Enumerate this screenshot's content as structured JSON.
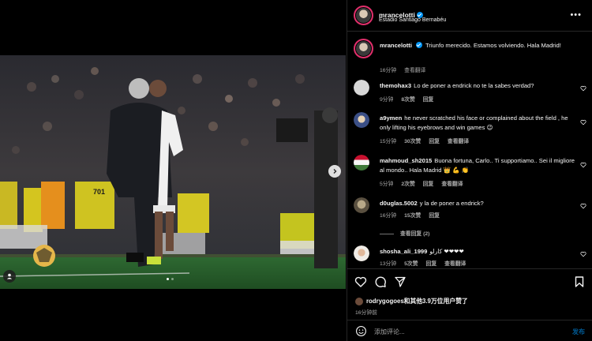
{
  "post": {
    "author": "mrancelotti",
    "location": "Estadio Santiago Bernabéu",
    "caption": "Triunfo merecido. Estamos volviendo. Hala Madrid!",
    "caption_time": "16分钟",
    "see_translation": "查看翻译"
  },
  "comments": [
    {
      "user": "themohax3",
      "text": "Lo de poner a endrick no te la sabes verdad?",
      "time": "9分钟",
      "likes": "8次赞",
      "reply": "回复",
      "translate": "",
      "avatar_color": "#d8d8d8"
    },
    {
      "user": "a9ymen",
      "text": "he never scratched his face or complained about the field , he only lifting his eyebrows and win games 😉",
      "time": "15分钟",
      "likes": "30次赞",
      "reply": "回复",
      "translate": "查看翻译",
      "avatar_color": "#4a5d8f"
    },
    {
      "user": "mahmoud_sh2015",
      "text": "Buona fortuna, Carlo.. Ti supportiamo.. Sei il migliore al mondo.. Hala Madrid 👑 💪 👏",
      "time": "5分钟",
      "likes": "2次赞",
      "reply": "回复",
      "translate": "查看翻译",
      "avatar_color": "#3f7a3a"
    },
    {
      "user": "d0uglas.5002",
      "text": "y la de poner a endrick?",
      "time": "16分钟",
      "likes": "15次赞",
      "reply": "回复",
      "translate": "",
      "avatar_color": "#8a7d5e",
      "view_replies": "查看回复 (2)"
    },
    {
      "user": "shosha_ali_1999",
      "text": "كارلو ❤❤❤❤",
      "time": "13分钟",
      "likes": "5次赞",
      "reply": "回复",
      "translate": "查看翻译",
      "avatar_color": "#c9b8a6"
    }
  ],
  "likes": {
    "text_user": "rodrygogoes",
    "text_rest": "和其他3.9万位用户赞了"
  },
  "post_time": "16分钟前",
  "comment_box": {
    "placeholder": "添加评论...",
    "post_label": "发布"
  },
  "colors": {
    "background": "#000000",
    "accent_blue": "#0095f6",
    "muted_text": "#a8a8a8",
    "divider": "#262626"
  }
}
